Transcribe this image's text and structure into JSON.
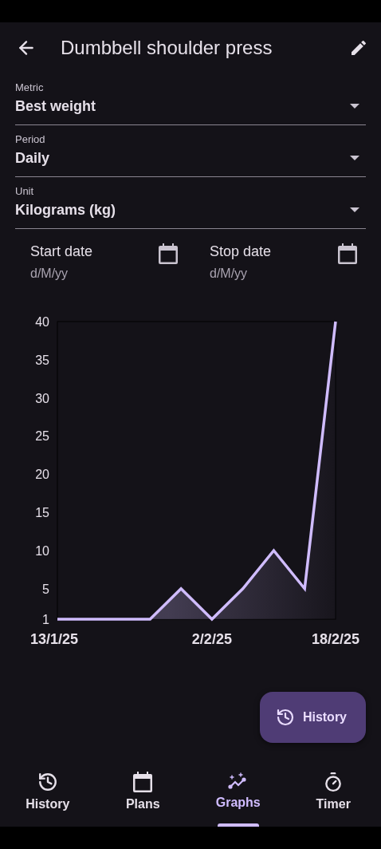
{
  "app_bar": {
    "title": "Dumbbell shoulder press"
  },
  "fields": [
    {
      "label": "Metric",
      "value": "Best weight"
    },
    {
      "label": "Period",
      "value": "Daily"
    },
    {
      "label": "Unit",
      "value": "Kilograms (kg)"
    }
  ],
  "dates": [
    {
      "label": "Start date",
      "placeholder": "d/M/yy"
    },
    {
      "label": "Stop date",
      "placeholder": "d/M/yy"
    }
  ],
  "chart": {
    "chart_data": {
      "type": "area",
      "categories": [
        "13/1/25",
        null,
        null,
        null,
        null,
        "2/2/25",
        null,
        null,
        null,
        "18/2/25"
      ],
      "series": [
        {
          "color": "#d0bcff",
          "values": [
            1,
            1,
            1,
            1,
            5,
            1,
            5,
            10,
            5,
            40
          ]
        }
      ],
      "ylim": [
        1,
        40
      ],
      "yticks": [
        1,
        5,
        10,
        15,
        20,
        25,
        30,
        35,
        40
      ]
    }
  },
  "fab": {
    "label": "History"
  },
  "nav": [
    {
      "label": "History",
      "kind": "history",
      "selected": false
    },
    {
      "label": "Plans",
      "kind": "plans",
      "selected": false
    },
    {
      "label": "Graphs",
      "kind": "graphs",
      "selected": true
    },
    {
      "label": "Timer",
      "kind": "timer",
      "selected": false
    }
  ]
}
